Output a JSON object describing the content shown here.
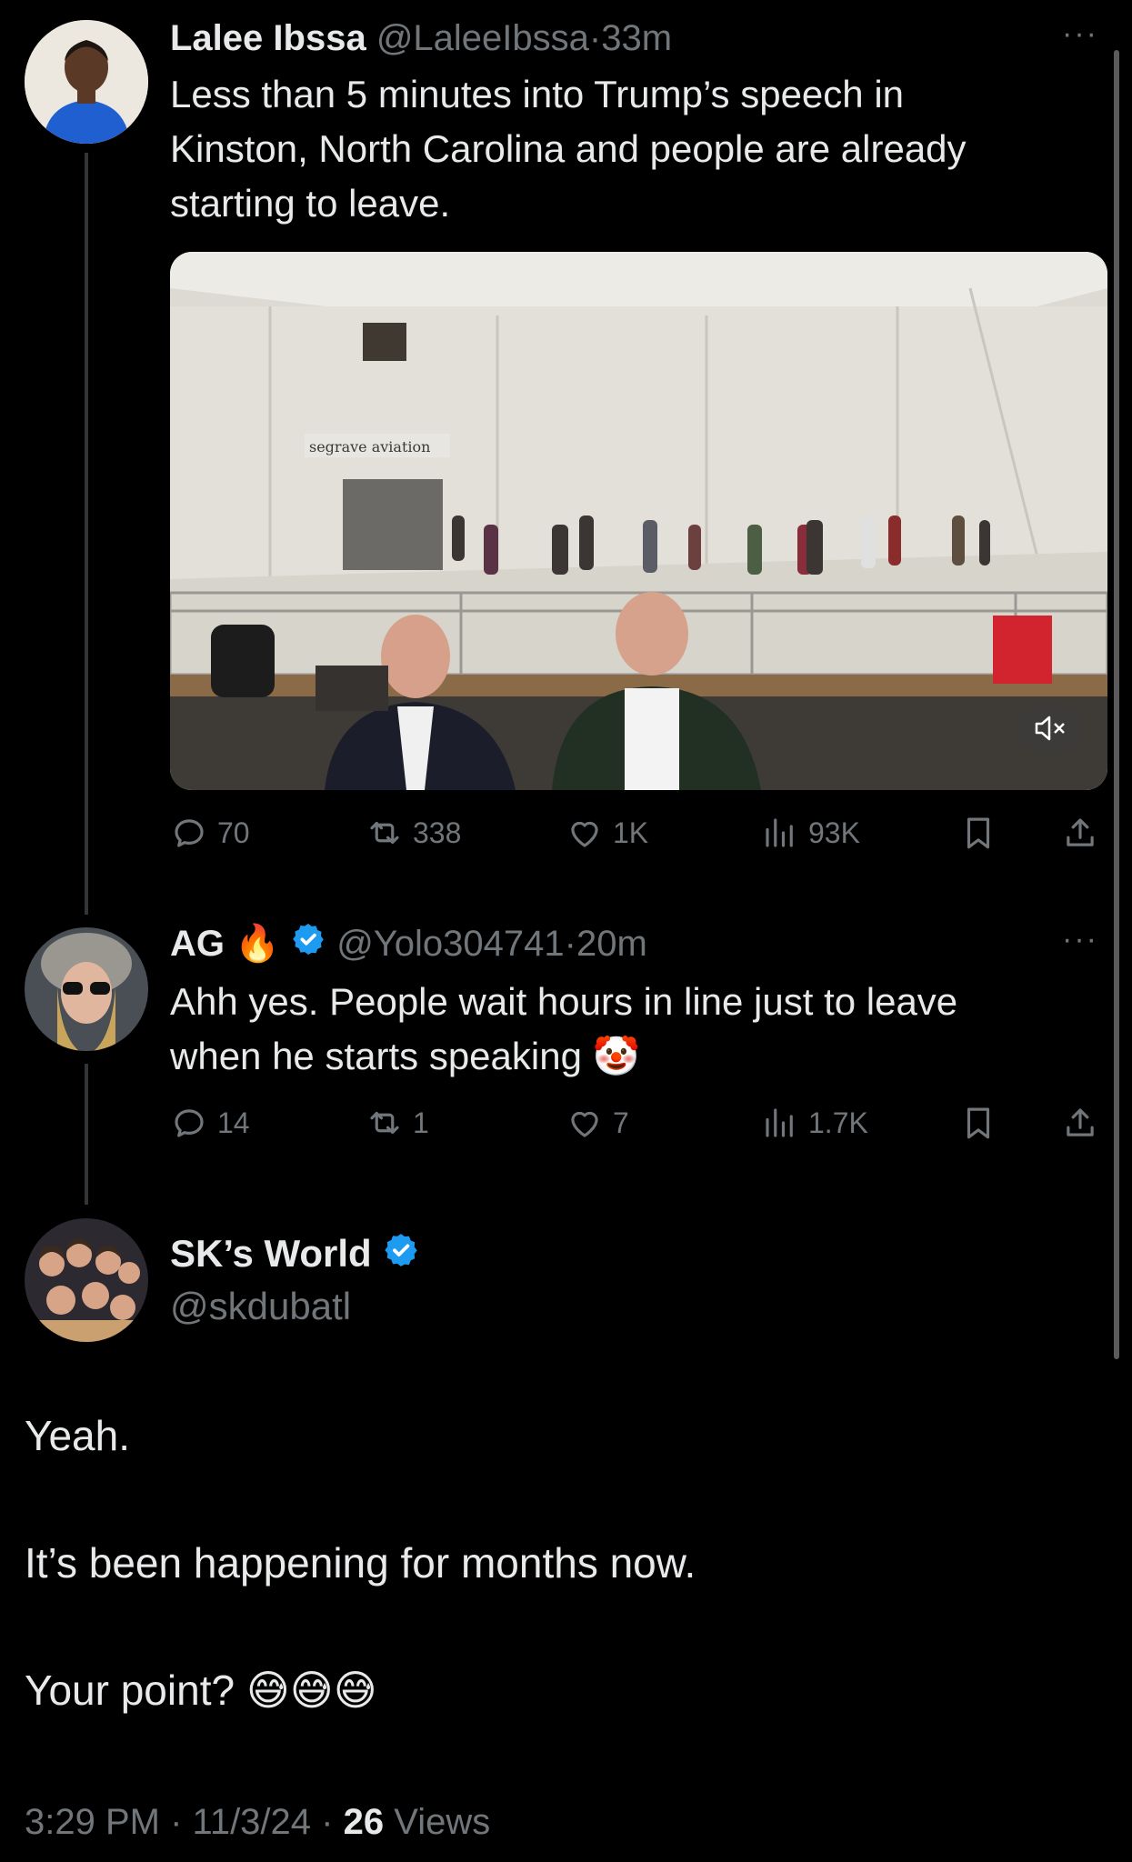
{
  "tweet1": {
    "display_name": "Lalee Ibssa",
    "handle": "@LaleeIbssa",
    "sep": "·",
    "time": "33m",
    "text_lines": [
      "Less than 5 minutes into Trump’s speech in",
      "Kinston, North Carolina and people are already",
      "starting to leave."
    ],
    "media_sign": "segrave aviation",
    "stats": {
      "replies": "70",
      "reposts": "338",
      "likes": "1K",
      "views": "93K"
    }
  },
  "tweet2": {
    "display_name": "AG",
    "name_emoji": "🔥",
    "handle": "@Yolo304741",
    "sep": "·",
    "time": "20m",
    "text_lines": [
      "Ahh yes. People wait hours in line just to leave",
      "when he starts speaking"
    ],
    "text_emoji": "🤡",
    "stats": {
      "replies": "14",
      "reposts": "1",
      "likes": "7",
      "views": "1.7K"
    }
  },
  "main": {
    "display_name": "SK’s World",
    "handle": "@skdubatl",
    "paragraphs": [
      "Yeah.",
      "It’s been happening for months now.",
      "Your point?"
    ],
    "emojis": "😅😅😅",
    "footer": {
      "time": "3:29 PM",
      "sep1": "·",
      "date": "11/3/24",
      "sep2": "·",
      "views_count": "26",
      "views_label": "Views"
    }
  },
  "more_label": "···",
  "colors": {
    "background": "#000000",
    "text": "#e7e9ea",
    "muted": "#71767b",
    "verified": "#1d9bf0",
    "thread_line": "#333639"
  },
  "icons": [
    "reply-icon",
    "repost-icon",
    "like-icon",
    "views-icon",
    "bookmark-icon",
    "share-icon",
    "mute-icon",
    "verified-badge-icon",
    "more-icon"
  ]
}
